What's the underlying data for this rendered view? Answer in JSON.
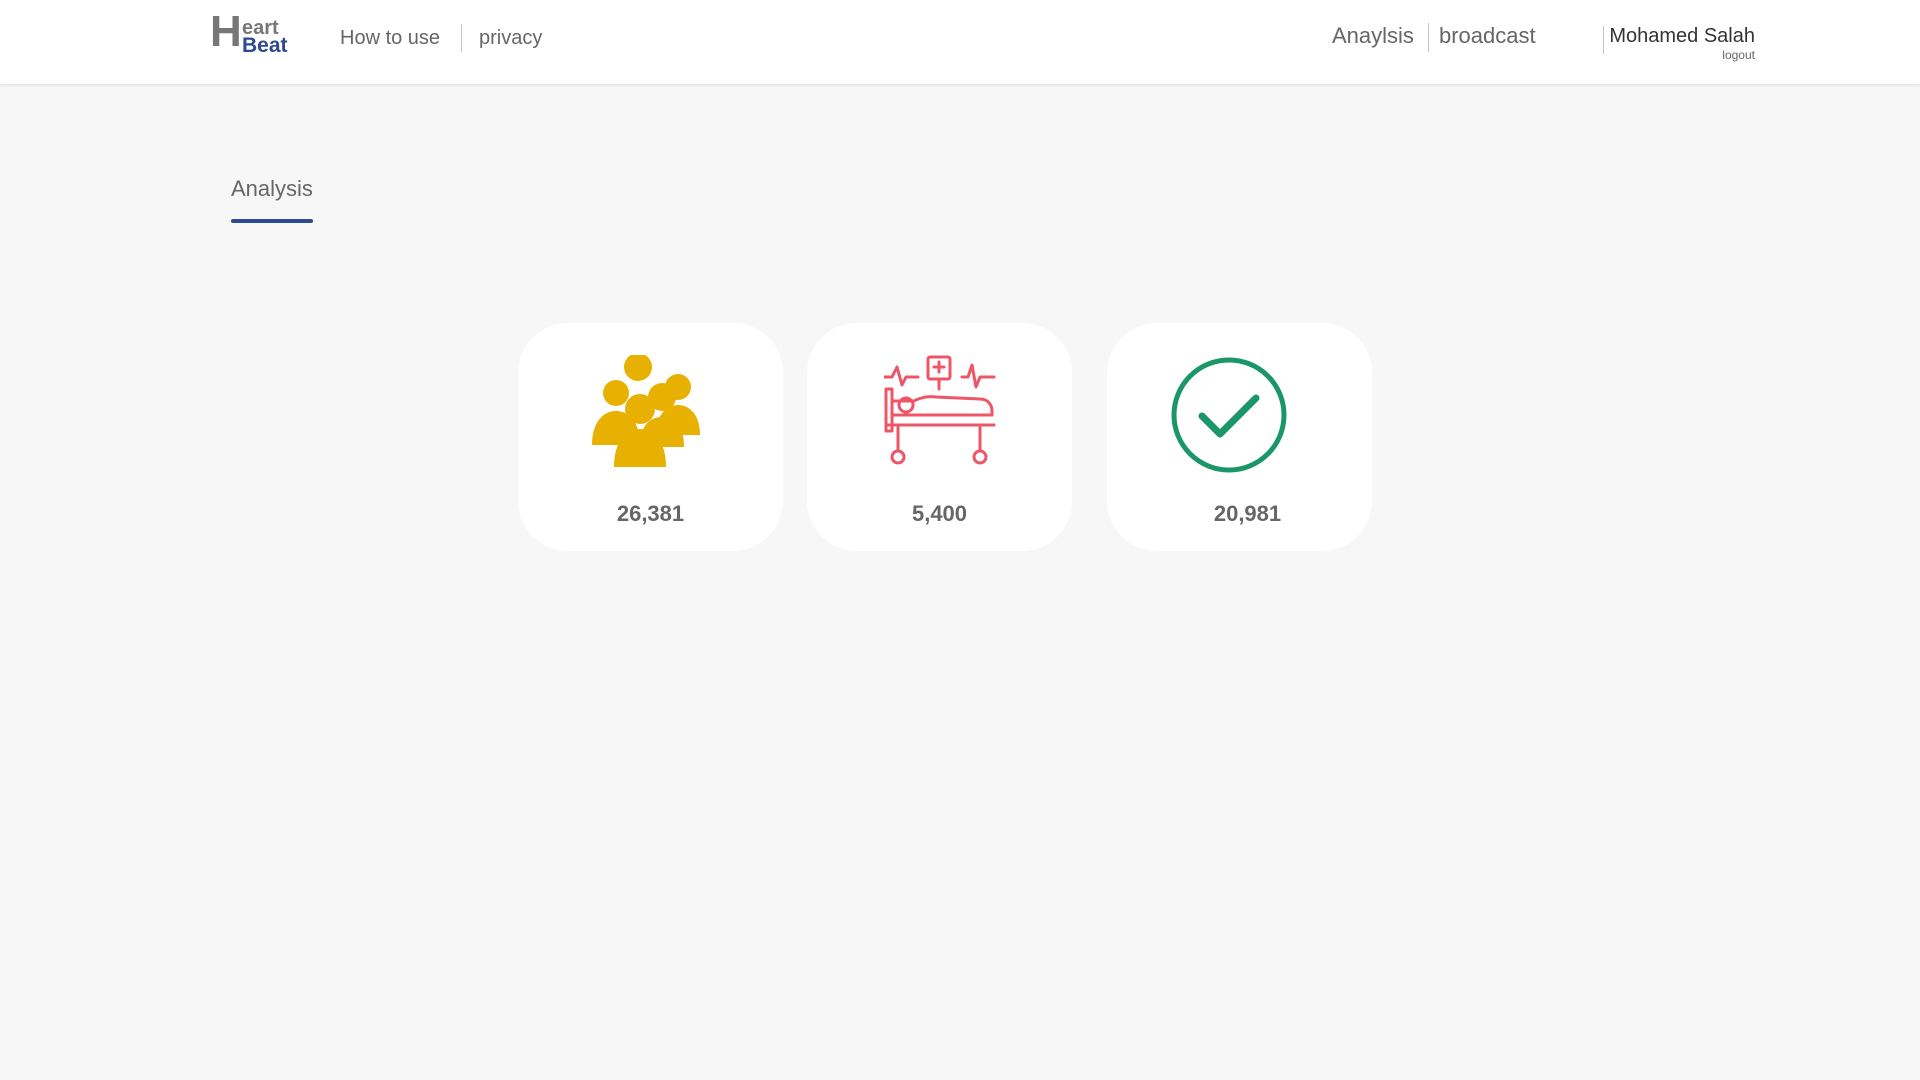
{
  "header": {
    "logo": {
      "letter": "H",
      "top": "eart",
      "bottom": "Beat"
    },
    "nav_left": [
      "How to use",
      "privacy"
    ],
    "nav_right": [
      "Anaylsis",
      "broadcast"
    ],
    "user": {
      "name": "Mohamed Salah",
      "logout": "logout"
    }
  },
  "tab": {
    "label": "Analysis"
  },
  "cards": [
    {
      "icon": "people-group-icon",
      "value": "26,381",
      "color": "#e8b000"
    },
    {
      "icon": "hospital-bed-icon",
      "value": "5,400",
      "color": "#ee5566"
    },
    {
      "icon": "check-circle-icon",
      "value": "20,981",
      "color": "#1a9668"
    }
  ],
  "colors": {
    "accent": "#2f4a94",
    "background": "#f7f7f7"
  }
}
